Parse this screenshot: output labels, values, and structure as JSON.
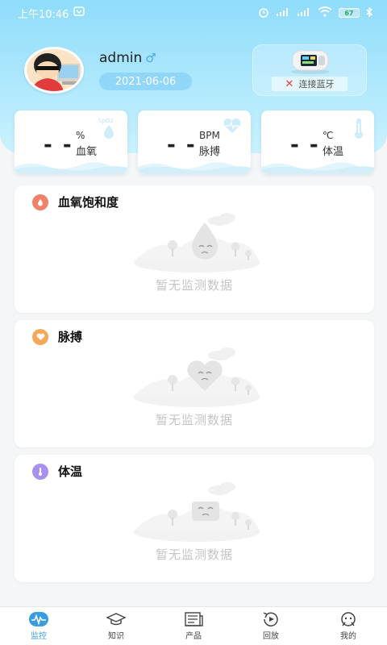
{
  "status": {
    "time": "上午10:46",
    "battery": "67"
  },
  "profile": {
    "username": "admin",
    "gender_symbol": "♂",
    "date": "2021-06-06"
  },
  "device": {
    "connect_label": "连接蓝牙",
    "status_icon": "x-icon"
  },
  "metrics": [
    {
      "value": "- -",
      "unit": "%",
      "label": "血氧",
      "icon": "spo2-icon"
    },
    {
      "value": "- -",
      "unit": "BPM",
      "label": "脉搏",
      "icon": "heart-icon"
    },
    {
      "value": "- -",
      "unit": "℃",
      "label": "体温",
      "icon": "thermometer-icon"
    }
  ],
  "sections": [
    {
      "title": "血氧饱和度",
      "empty_text": "暂无监测数据",
      "color": "#f0826a"
    },
    {
      "title": "脉搏",
      "empty_text": "暂无监测数据",
      "color": "#f5a85c"
    },
    {
      "title": "体温",
      "empty_text": "暂无监测数据",
      "color": "#a890f0"
    }
  ],
  "tabs": [
    {
      "label": "监控",
      "icon": "pulse-icon",
      "active": true
    },
    {
      "label": "知识",
      "icon": "graduation-cap-icon",
      "active": false
    },
    {
      "label": "产品",
      "icon": "newspaper-icon",
      "active": false
    },
    {
      "label": "回放",
      "icon": "replay-icon",
      "active": false
    },
    {
      "label": "我的",
      "icon": "profile-face-icon",
      "active": false
    }
  ],
  "colors": {
    "accent": "#3a9be0",
    "header_top": "#8fdcfb"
  }
}
